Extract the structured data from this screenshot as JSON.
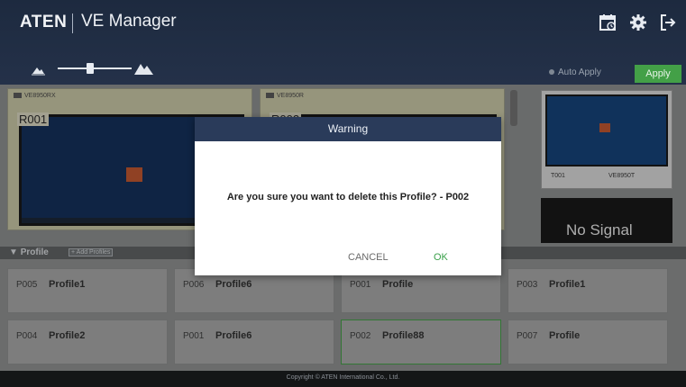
{
  "header": {
    "brand": "ATEN",
    "title": "VE Manager",
    "icons": [
      "calendar-icon",
      "gear-icon",
      "logout-icon"
    ],
    "auto_apply_label": "Auto Apply",
    "apply_label": "Apply",
    "accent_color": "#43a047"
  },
  "displays": [
    {
      "name": "VE8950RX",
      "label": "R001"
    },
    {
      "name": "VE8950R",
      "label": "R002"
    }
  ],
  "right_panel": {
    "thumb_left": "T001",
    "thumb_right": "VE8950T",
    "no_signal": "No Signal"
  },
  "profile_section": {
    "title": "Profile",
    "add_label": "+ Add Profiles",
    "cards": [
      {
        "id": "P005",
        "name": "Profile1"
      },
      {
        "id": "P006",
        "name": "Profile6"
      },
      {
        "id": "P001",
        "name": "Profile"
      },
      {
        "id": "P003",
        "name": "Profile1"
      },
      {
        "id": "P004",
        "name": "Profile2"
      },
      {
        "id": "P001",
        "name": "Profile6"
      },
      {
        "id": "P002",
        "name": "Profile88"
      },
      {
        "id": "P007",
        "name": "Profile"
      }
    ]
  },
  "footer": {
    "copyright": "Copyright © ATEN International Co., Ltd."
  },
  "dialog": {
    "title": "Warning",
    "message": "Are you sure you want to delete this Profile? - P002",
    "cancel_label": "CANCEL",
    "ok_label": "OK"
  }
}
